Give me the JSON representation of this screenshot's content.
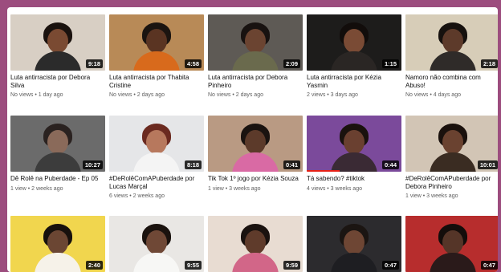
{
  "videos": [
    {
      "title": "Luta antirracista por Debora Silva",
      "meta": "No views • 1 day ago",
      "duration": "9:18",
      "wall": "#d8cfc4",
      "body": "#2b2b2b",
      "skin": "#7a4a32",
      "hair": "#1a120e",
      "progress": 0
    },
    {
      "title": "Luta antirracista por Thabita Cristine",
      "meta": "No views • 2 days ago",
      "duration": "4:58",
      "wall": "#b88a57",
      "body": "#d86a1c",
      "skin": "#5a3422",
      "hair": "#1b1410",
      "progress": 0
    },
    {
      "title": "Luta antirracista por Debora Pinheiro",
      "meta": "No views • 2 days ago",
      "duration": "2:09",
      "wall": "#5e5a55",
      "body": "#6a6a4d",
      "skin": "#6b4431",
      "hair": "#181210",
      "progress": 0
    },
    {
      "title": "Luta antirracista por Kézia Yasmin",
      "meta": "2 views • 3 days ago",
      "duration": "1:15",
      "wall": "#1d1c1b",
      "body": "#2a2624",
      "skin": "#7a4b35",
      "hair": "#120d0b",
      "progress": 0
    },
    {
      "title": "Namoro não combina com Abuso!",
      "meta": "No views • 4 days ago",
      "duration": "2:18",
      "wall": "#d7cdb8",
      "body": "#2f2b29",
      "skin": "#5d3a2a",
      "hair": "#16110e",
      "progress": 0
    },
    {
      "title": "Dê Rolê na Puberdade - Ep 05",
      "meta": "1 view • 2 weeks ago",
      "duration": "10:27",
      "wall": "#6b6b6b",
      "body": "#3c3c3c",
      "skin": "#8a6a5a",
      "hair": "#2a2220",
      "progress": 0
    },
    {
      "title": "#DeRolêComAPuberdade por Lucas Marçal",
      "meta": "6 views • 2 weeks ago",
      "duration": "8:18",
      "wall": "#e5e6e8",
      "body": "#f4f4f4",
      "skin": "#b7785d",
      "hair": "#6b2a20",
      "progress": 0
    },
    {
      "title": "Tik Tok 1º jogo por Kézia Souza",
      "meta": "1 view • 3 weeks ago",
      "duration": "0:41",
      "wall": "#b99a83",
      "body": "#d96aa4",
      "skin": "#5c3a2a",
      "hair": "#1a1310",
      "progress": 0
    },
    {
      "title": "Tá sabendo? #tiktok",
      "meta": "4 views • 3 weeks ago",
      "duration": "0:44",
      "wall": "#7b4a9b",
      "body": "#3a2a34",
      "skin": "#6a4030",
      "hair": "#1a120e",
      "progress": 0.35
    },
    {
      "title": "#DeRolêComAPuberdade por Debora Pinheiro",
      "meta": "1 view • 3 weeks ago",
      "duration": "10:01",
      "wall": "#d2c5b5",
      "body": "#3a2c22",
      "skin": "#6a4230",
      "hair": "#1a110d",
      "progress": 0
    },
    {
      "title": "",
      "meta": "",
      "duration": "2:40",
      "wall": "#f1d64e",
      "body": "#f6f2e9",
      "skin": "#6b4633",
      "hair": "#17110d",
      "progress": 0
    },
    {
      "title": "",
      "meta": "",
      "duration": "9:55",
      "wall": "#e9e7e4",
      "body": "#f7f7f5",
      "skin": "#6f4836",
      "hair": "#1a120e",
      "progress": 0
    },
    {
      "title": "",
      "meta": "",
      "duration": "9:59",
      "wall": "#e8dcd2",
      "body": "#d26688",
      "skin": "#5f3b2b",
      "hair": "#1a120f",
      "progress": 0
    },
    {
      "title": "",
      "meta": "",
      "duration": "0:47",
      "wall": "#2c2b2e",
      "body": "#1e1e22",
      "skin": "#6e4634",
      "hair": "#1b1512",
      "progress": 0
    },
    {
      "title": "",
      "meta": "",
      "duration": "0:47",
      "wall": "#b72d2d",
      "body": "#2a1a1a",
      "skin": "#553528",
      "hair": "#140d0b",
      "progress": 0
    }
  ]
}
